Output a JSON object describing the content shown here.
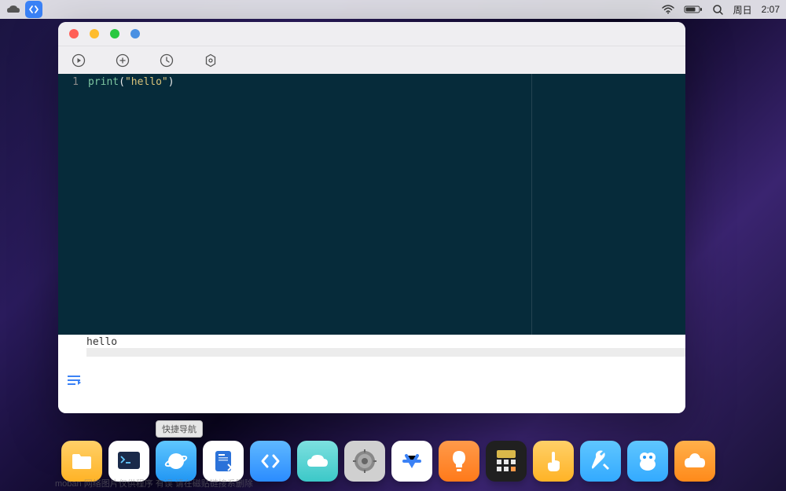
{
  "menubar": {
    "day_label": "周日",
    "time": "2:07"
  },
  "toolbar": {
    "run_tip": "Run",
    "add_tip": "Add",
    "history_tip": "History",
    "settings_tip": "Settings"
  },
  "editor": {
    "line_number": "1",
    "code_fn": "print",
    "code_lparen": "(",
    "code_str": "\"hello\"",
    "code_rparen": ")"
  },
  "output": {
    "text": "hello"
  },
  "tooltip": {
    "text": "快捷导航"
  },
  "watermark": {
    "text": "moban         网络图片仅供程序         有误    请在磁贴链接系删除"
  },
  "dock": {
    "items": [
      "files",
      "terminal",
      "browser",
      "manual",
      "code",
      "cloud",
      "settings",
      "store",
      "tips",
      "calc",
      "touch",
      "tools",
      "mouse",
      "logo"
    ]
  }
}
